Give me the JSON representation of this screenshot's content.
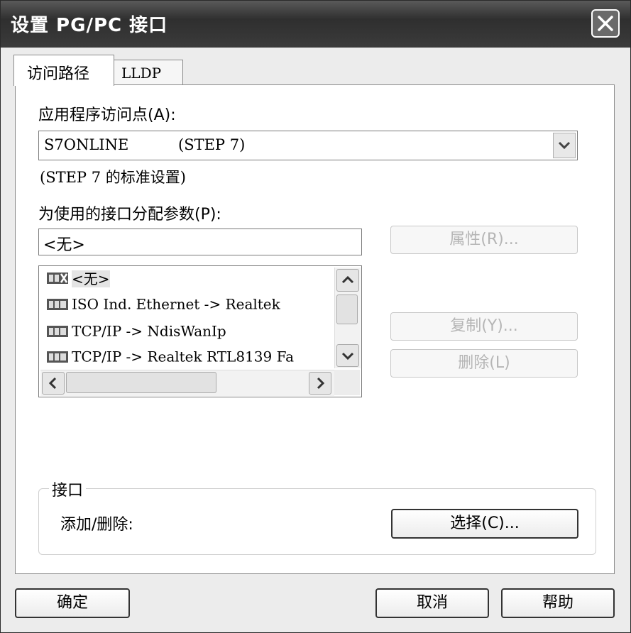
{
  "window": {
    "title": "设置 PG/PC 接口"
  },
  "tabs": [
    {
      "label": "访问路径",
      "active": true
    },
    {
      "label": "LLDP",
      "active": false
    }
  ],
  "access_point": {
    "label": "应用程序访问点(A):",
    "value_name": "S7ONLINE",
    "value_detail": "(STEP 7)",
    "description": "(STEP 7 的标准设置)"
  },
  "interface_param": {
    "label": "为使用的接口分配参数(P):",
    "value": "<无>"
  },
  "interface_list": {
    "items": [
      "<无>",
      "ISO Ind. Ethernet -> Realtek",
      "TCP/IP -> NdisWanIp",
      "TCP/IP -> Realtek RTL8139 Fa"
    ],
    "selected_index": 0
  },
  "buttons": {
    "properties": "属性(R)...",
    "copy": "复制(Y)...",
    "delete": "删除(L)",
    "select": "选择(C)...",
    "ok": "确定",
    "cancel": "取消",
    "help": "帮助"
  },
  "interface_group": {
    "title": "接口",
    "add_remove_label": "添加/删除:"
  },
  "icons": [
    "close-icon",
    "dropdown-arrow-icon",
    "network-card-icon",
    "scroll-up-icon",
    "scroll-down-icon",
    "scroll-left-icon",
    "scroll-right-icon"
  ]
}
